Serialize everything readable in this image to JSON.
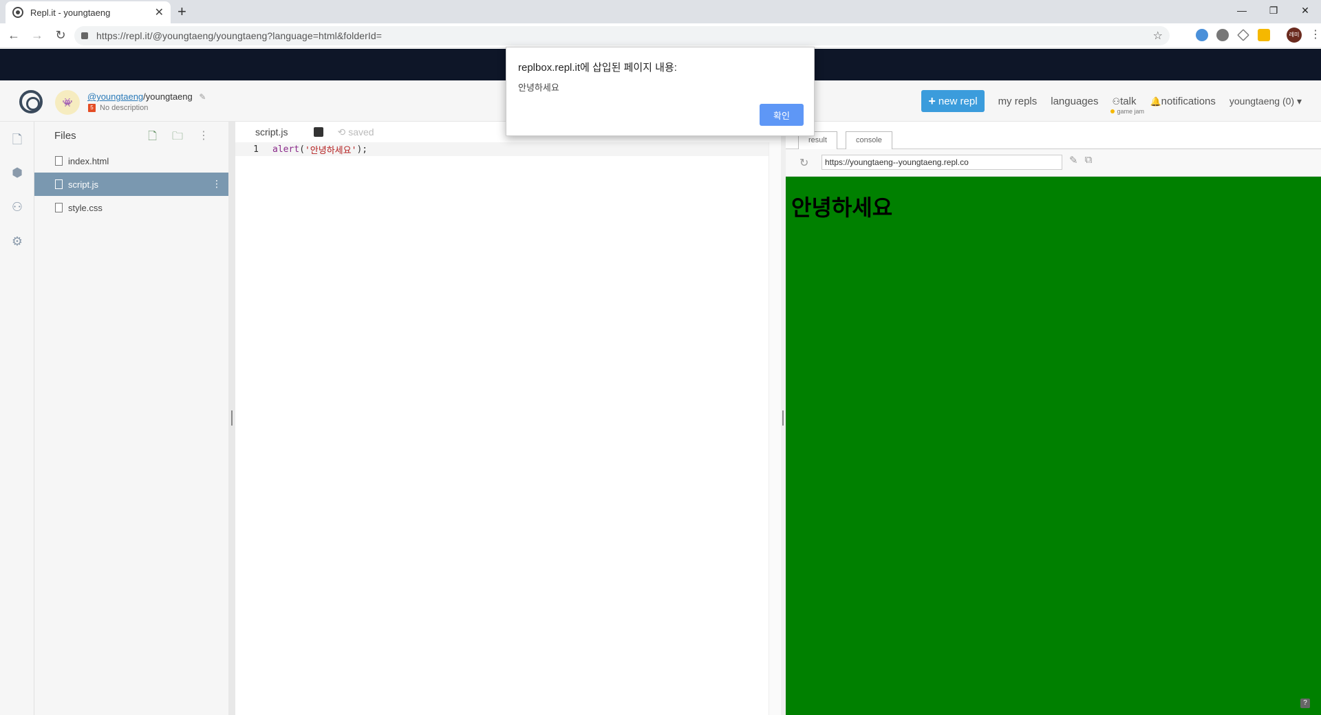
{
  "browser": {
    "tab_title": "Repl.it - youngtaeng",
    "tab_close": "✕",
    "new_tab": "+",
    "url": "https://repl.it/@youngtaeng/youngtaeng?language=html&folderId=",
    "profile_initials": "레미",
    "window_controls": [
      "—",
      "❐",
      "✕"
    ]
  },
  "header": {
    "owner": "@youngtaeng",
    "separator": "/",
    "repl_name": "youngtaeng",
    "description": "No description",
    "new_repl": "new repl",
    "nav": [
      "my repls",
      "languages",
      "talk",
      "notifications"
    ],
    "talk_sub": "game jam",
    "user_menu": "youngtaeng (0)"
  },
  "files": {
    "title": "Files",
    "items": [
      {
        "name": "index.html",
        "active": false
      },
      {
        "name": "script.js",
        "active": true
      },
      {
        "name": "style.css",
        "active": false
      }
    ]
  },
  "editor": {
    "active_tab": "script.js",
    "status": "saved",
    "code_lines": [
      {
        "num": "1",
        "fn": "alert",
        "open": "(",
        "str": "'안녕하세요'",
        "close": ");"
      }
    ]
  },
  "output": {
    "tabs": [
      "result",
      "console"
    ],
    "active_tab": "result",
    "url": "https://youngtaeng--youngtaeng.repl.co",
    "heading": "안녕하세요",
    "help": "?",
    "background_color": "#008000"
  },
  "alert": {
    "title": "replbox.repl.it에 삽입된 페이지 내용:",
    "message": "안녕하세요",
    "ok": "확인"
  }
}
